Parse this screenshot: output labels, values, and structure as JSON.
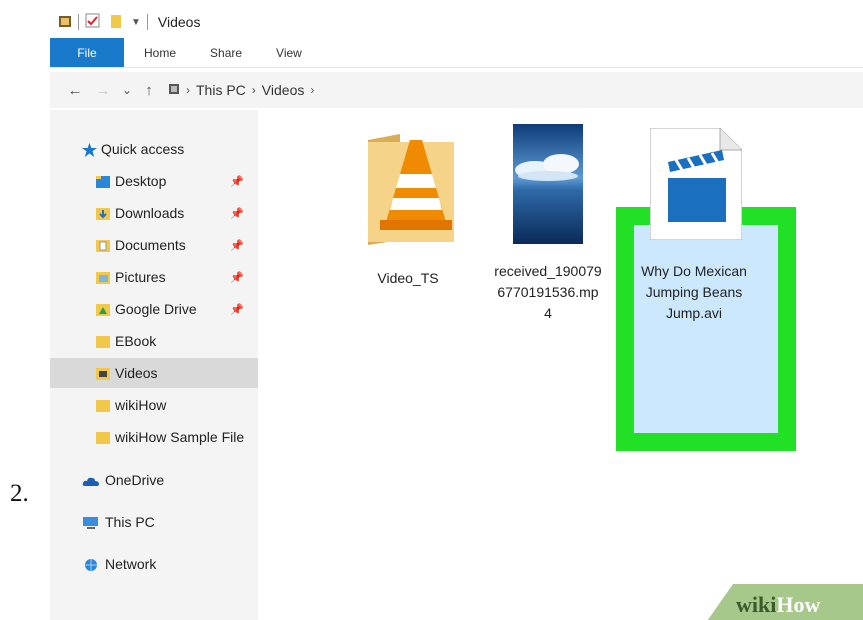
{
  "step_number": "2.",
  "window": {
    "title": "Videos",
    "ribbon_tabs": [
      "File",
      "Home",
      "Share",
      "View"
    ],
    "address": {
      "back": "←",
      "forward": "→",
      "history": "⌄",
      "up": "↑",
      "path": [
        "This PC",
        "Videos"
      ]
    },
    "sidebar": {
      "quick_access": "Quick access",
      "items": [
        {
          "label": "Desktop",
          "icon": "desktop-folder-icon",
          "pinned": true
        },
        {
          "label": "Downloads",
          "icon": "downloads-folder-icon",
          "pinned": true
        },
        {
          "label": "Documents",
          "icon": "documents-folder-icon",
          "pinned": true
        },
        {
          "label": "Pictures",
          "icon": "pictures-folder-icon",
          "pinned": true
        },
        {
          "label": "Google Drive",
          "icon": "google-drive-icon",
          "pinned": true
        },
        {
          "label": "EBook",
          "icon": "folder-icon",
          "pinned": false
        },
        {
          "label": "Videos",
          "icon": "videos-folder-icon",
          "pinned": false,
          "selected": true
        },
        {
          "label": "wikiHow",
          "icon": "folder-icon",
          "pinned": false
        },
        {
          "label": "wikiHow Sample File",
          "icon": "folder-icon",
          "pinned": false
        }
      ],
      "onedrive": "OneDrive",
      "this_pc": "This PC",
      "network": "Network"
    },
    "files": [
      {
        "name": "Video_TS",
        "kind": "folder-vlc-icon"
      },
      {
        "name_lines": [
          "received_190079",
          "6770191536.mp",
          "4"
        ],
        "kind": "video-thumbnail",
        "selected": true
      },
      {
        "name_lines": [
          "Why Do Mexican",
          "Jumping Beans",
          "Jump.avi"
        ],
        "kind": "clapperboard-icon"
      }
    ],
    "highlight_color": "#22e026",
    "accent_color": "#1979ca"
  },
  "watermark": {
    "part1": "wiki",
    "part2": "How"
  }
}
